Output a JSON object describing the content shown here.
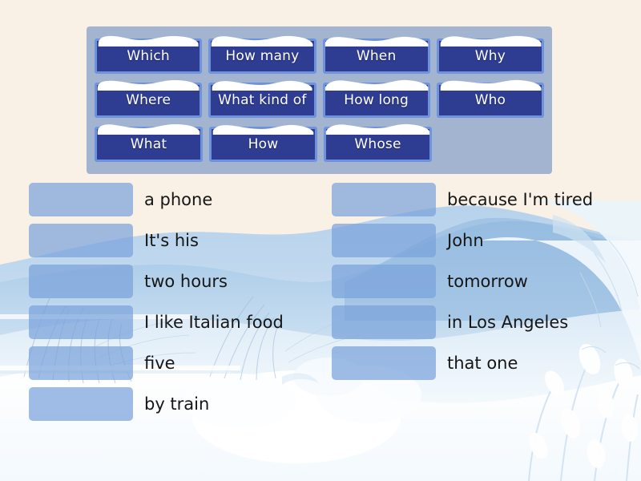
{
  "theme": {
    "page_background": "#faf1e6",
    "panel_background": "#a3b4d1",
    "tile_fill": "#2e3c91",
    "tile_border": "#6f92dd",
    "tile_text": "#ffffff",
    "snow_cap": "#ffffff",
    "dropzone_fill": "#7aa2db",
    "answer_text": "#161616"
  },
  "wordbank": {
    "rows": [
      [
        {
          "label": "Which"
        },
        {
          "label": "How many"
        },
        {
          "label": "When"
        },
        {
          "label": "Why"
        }
      ],
      [
        {
          "label": "Where"
        },
        {
          "label": "What kind of"
        },
        {
          "label": "How long"
        },
        {
          "label": "Who"
        }
      ],
      [
        {
          "label": "What"
        },
        {
          "label": "How"
        },
        {
          "label": "Whose"
        }
      ]
    ]
  },
  "answers": {
    "left_column": [
      {
        "text": "a phone"
      },
      {
        "text": "It's his"
      },
      {
        "text": "two hours"
      },
      {
        "text": "I like Italian food"
      },
      {
        "text": "five"
      },
      {
        "text": "by train"
      }
    ],
    "right_column": [
      {
        "text": "because I'm tired"
      },
      {
        "text": "John"
      },
      {
        "text": "tomorrow"
      },
      {
        "text": "in Los Angeles"
      },
      {
        "text": "that one"
      }
    ]
  }
}
